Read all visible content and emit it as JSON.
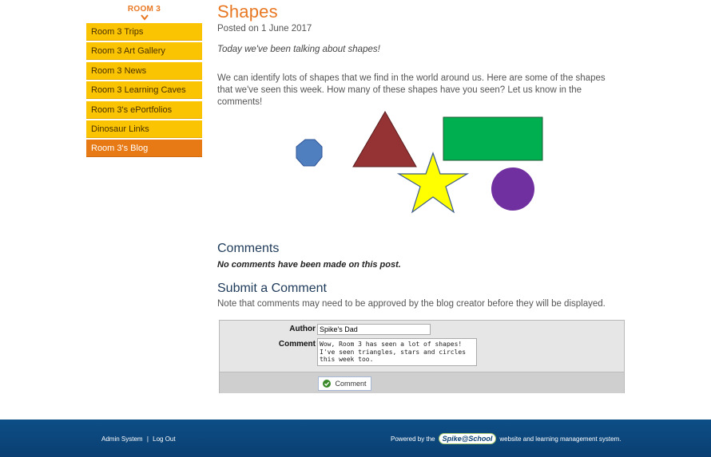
{
  "sidebar": {
    "heading": "ROOM 3",
    "items": [
      {
        "label": "Room 3 Trips",
        "active": false
      },
      {
        "label": "Room 3 Art Gallery",
        "active": false
      },
      {
        "label": "Room 3 News",
        "active": false
      },
      {
        "label": "Room 3 Learning Caves",
        "active": false
      },
      {
        "label": "Room 3's ePortfolios",
        "active": false
      },
      {
        "label": "Dinosaur Links",
        "active": false
      },
      {
        "label": "Room 3's Blog",
        "active": true
      }
    ]
  },
  "post": {
    "title": "Shapes",
    "date": "Posted on 1 June 2017",
    "intro": "Today we've been talking about shapes!",
    "body": "We can identify lots of shapes that we find in the world around us. Here are some of the shapes that we've seen this week. How many of these shapes have you seen? Let us know in the comments!",
    "shape_colors": {
      "octagon": "#4f7fbf",
      "triangle": "#953234",
      "rectangle": "#00b050",
      "star": "#ffff00",
      "circle": "#7030a0"
    }
  },
  "comments": {
    "title": "Comments",
    "empty_message": "No comments have been made on this post."
  },
  "submit": {
    "title": "Submit a Comment",
    "note": "Note that comments may need to be approved by the blog creator before they will be displayed.",
    "author_label": "Author",
    "author_value": "Spike's Dad",
    "comment_label": "Comment",
    "comment_value": "Wow, Room 3 has seen a lot of shapes!\nI've seen triangles, stars and circles this week too.",
    "button_label": "Comment"
  },
  "footer": {
    "admin_link": "Admin System",
    "separator": "|",
    "logout_link": "Log Out",
    "powered_prefix": "Powered by the",
    "logo_text": "Spike@School",
    "powered_suffix": "website and learning management system."
  }
}
